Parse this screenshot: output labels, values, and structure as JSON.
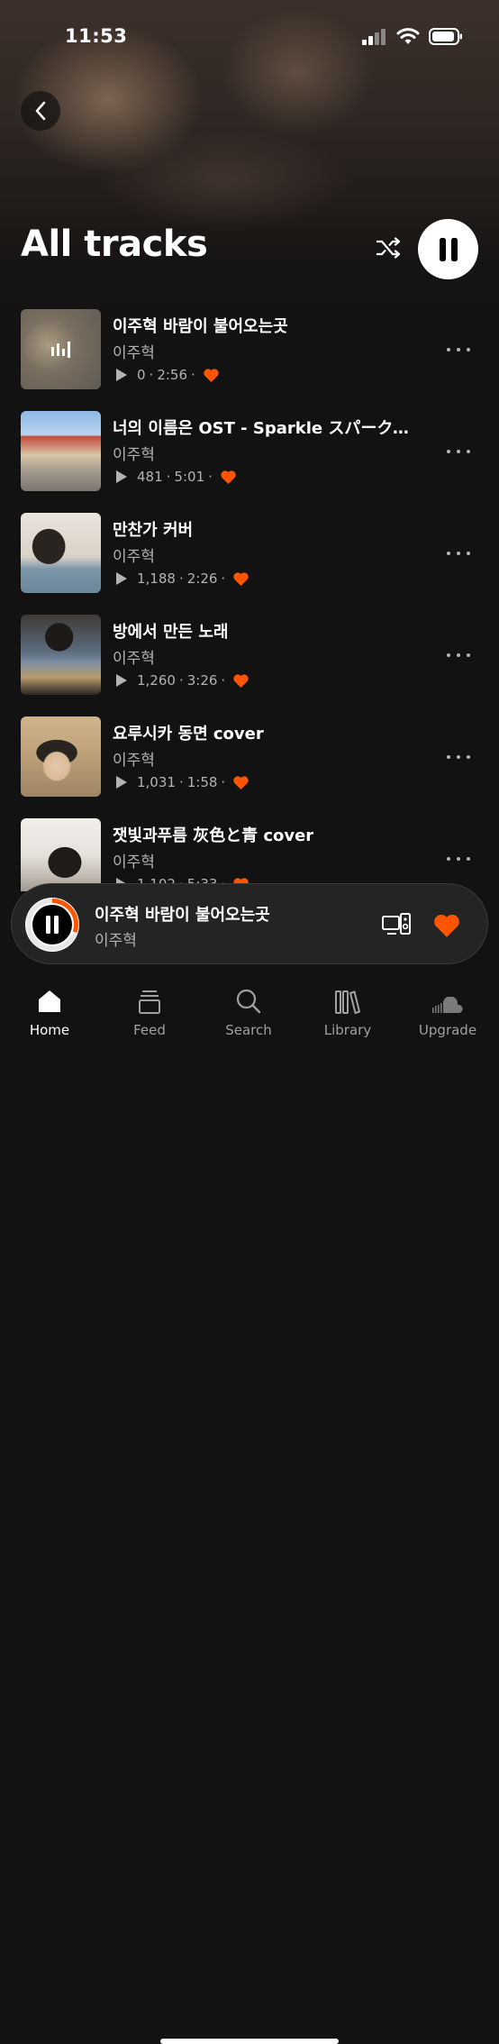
{
  "status": {
    "time": "11:53"
  },
  "header": {
    "title": "All tracks"
  },
  "tracks": [
    {
      "title": "이주혁 바람이 불어오는곳",
      "artist": "이주혁",
      "plays": "0",
      "duration": "2:56",
      "liked": true,
      "now_playing": true
    },
    {
      "title": "너의 이름은 OST - Sparkle スパークル...",
      "artist": "이주혁",
      "plays": "481",
      "duration": "5:01",
      "liked": true
    },
    {
      "title": "만찬가 커버",
      "artist": "이주혁",
      "plays": "1,188",
      "duration": "2:26",
      "liked": true
    },
    {
      "title": "방에서 만든 노래",
      "artist": "이주혁",
      "plays": "1,260",
      "duration": "3:26",
      "liked": true
    },
    {
      "title": "요루시카 동면 cover",
      "artist": "이주혁",
      "plays": "1,031",
      "duration": "1:58",
      "liked": true
    },
    {
      "title": "잿빛과푸름 灰色と青 cover",
      "artist": "이주혁",
      "plays": "1,102",
      "duration": "5:33",
      "liked": true
    }
  ],
  "mini_player": {
    "title": "이주혁 바람이 불어오는곳",
    "artist": "이주혁",
    "progress": 0.3
  },
  "tabs": [
    {
      "label": "Home",
      "icon": "home-icon",
      "active": true
    },
    {
      "label": "Feed",
      "icon": "feed-icon"
    },
    {
      "label": "Search",
      "icon": "search-icon"
    },
    {
      "label": "Library",
      "icon": "library-icon"
    },
    {
      "label": "Upgrade",
      "icon": "soundcloud-icon"
    }
  ],
  "colors": {
    "accent": "#ff5500",
    "background": "#121212",
    "muted": "#b3b3b3"
  }
}
